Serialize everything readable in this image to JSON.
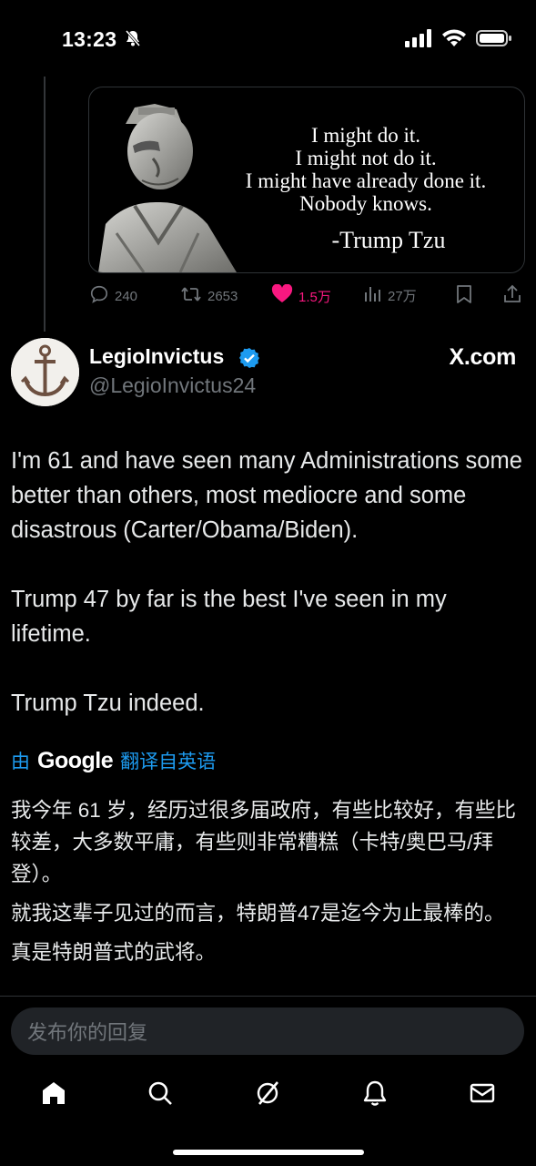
{
  "status_bar": {
    "time": "13:23"
  },
  "quoted_image": {
    "lines": [
      "I might do it.",
      "I might not do it.",
      "I might have already done it.",
      "Nobody knows."
    ],
    "signature": "-Trump Tzu"
  },
  "engagement": {
    "replies": "240",
    "reposts": "2653",
    "likes": "1.5万",
    "views": "27万"
  },
  "post": {
    "display_name": "LegioInvictus",
    "handle": "@LegioInvictus24",
    "watermark": "X.com",
    "paragraphs": [
      "I'm 61 and have seen many Administrations some better than others, most mediocre and some disastrous (Carter/Obama/Biden).",
      "Trump 47 by far is the best I've seen in my lifetime.",
      "Trump Tzu indeed."
    ]
  },
  "translation": {
    "prefix": "由",
    "provider": "Google",
    "suffix": "翻译自英语",
    "paragraphs": [
      "我今年 61 岁，经历过很多届政府，有些比较好，有些比较差，大多数平庸，有些则非常糟糕（卡特/奥巴马/拜登）。",
      "就我这辈子见过的而言，特朗普47是迄今为止最棒的。",
      "真是特朗普式的武将。"
    ]
  },
  "reply_box": {
    "placeholder": "发布你的回复"
  },
  "tabs": [
    "home-icon",
    "search-icon",
    "grok-icon",
    "notifications-icon",
    "messages-icon"
  ],
  "colors": {
    "like": "#f91880",
    "link": "#1d9bf0",
    "verified": "#1d9bf0",
    "muted": "#71767b"
  }
}
